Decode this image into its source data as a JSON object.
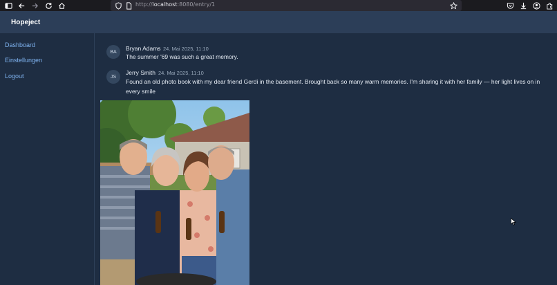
{
  "browser": {
    "url_prefix": "http://",
    "url_host": "localhost",
    "url_rest": ":8080/entry/1"
  },
  "app": {
    "brand": "Hopeject"
  },
  "sidebar": {
    "items": [
      {
        "label": "Dashboard"
      },
      {
        "label": "Einstellungen"
      },
      {
        "label": "Logout"
      }
    ]
  },
  "entries": [
    {
      "initials": "BA",
      "author": "Bryan Adams",
      "timestamp": "24. Mai 2025, 11:10",
      "text": "The summer '69 was such a great memory."
    },
    {
      "initials": "JS",
      "author": "Jerry Smith",
      "timestamp": "24. Mai 2025, 11:10",
      "text_line1": "Found an old photo book with my dear friend Gerdi in the basement. Brought back so many warm memories. I'm sharing it with her family — her light lives on in",
      "text_line2": "every smile"
    }
  ],
  "colors": {
    "background": "#1e2d42",
    "header": "#2c3e58",
    "link": "#7fb3f0"
  }
}
